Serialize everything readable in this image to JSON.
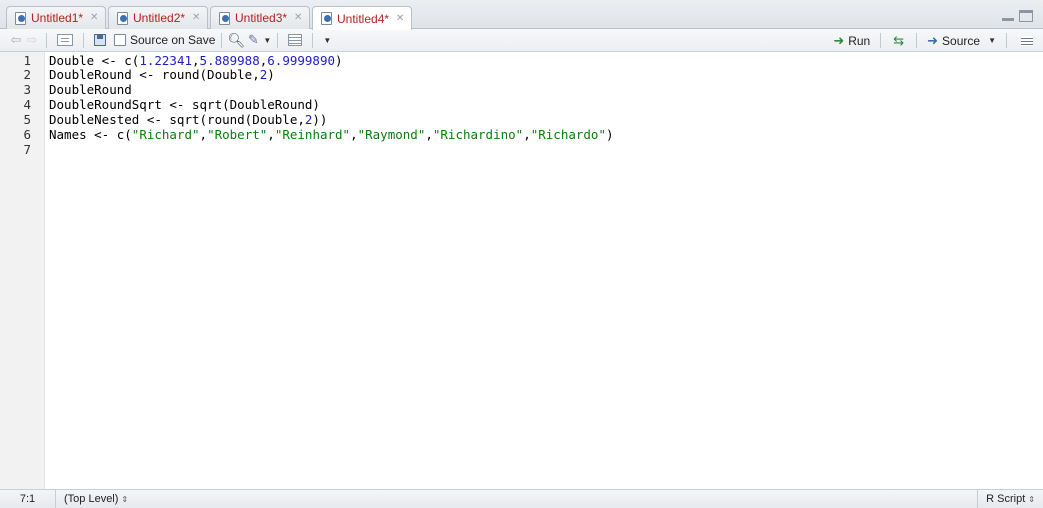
{
  "tabs": [
    {
      "label": "Untitled1*",
      "active": false
    },
    {
      "label": "Untitled2*",
      "active": false
    },
    {
      "label": "Untitled3*",
      "active": false
    },
    {
      "label": "Untitled4*",
      "active": true
    }
  ],
  "toolbar": {
    "source_on_save_label": "Source on Save",
    "run_label": "Run",
    "source_label": "Source"
  },
  "editor": {
    "line_numbers": [
      "1",
      "2",
      "3",
      "4",
      "5",
      "6",
      "7"
    ],
    "lines": [
      "Double <- c(1.22341,5.889988,6.9999890)",
      "DoubleRound <- round(Double,2)",
      "DoubleRound",
      "DoubleRoundSqrt <- sqrt(DoubleRound)",
      "DoubleNested <- sqrt(round(Double,2))",
      "Names <- c(\"Richard\",\"Robert\",\"Reinhard\",\"Raymond\",\"Richardino\",\"Richardo\")",
      ""
    ]
  },
  "status": {
    "cursor_position": "7:1",
    "scope": "(Top Level)",
    "file_type": "R Script"
  },
  "colors": {
    "tab_label": "#b22222",
    "number_token": "#1d1dc4",
    "string_token": "#0b7d0b",
    "run_green": "#2e8b3a"
  }
}
